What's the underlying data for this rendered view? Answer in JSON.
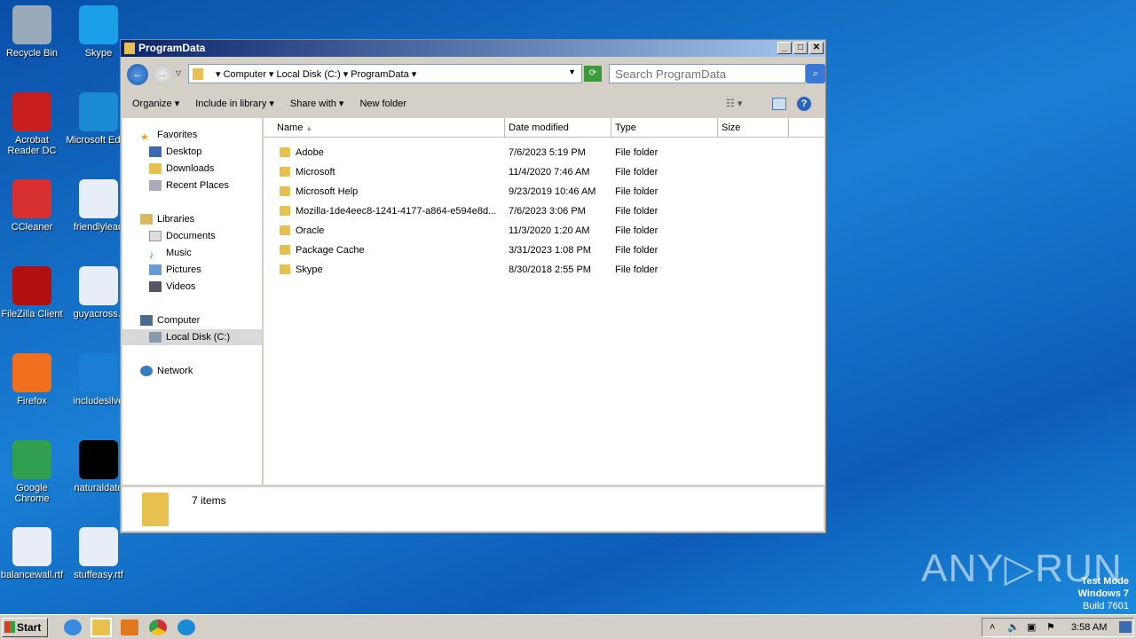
{
  "desktop": {
    "icons": [
      {
        "label": "Recycle Bin",
        "color": "#9ab"
      },
      {
        "label": "Skype",
        "color": "#1a9fe8"
      },
      {
        "label": "Acrobat Reader DC",
        "color": "#c81e1e"
      },
      {
        "label": "Microsoft Edge",
        "color": "#1a8ad4"
      },
      {
        "label": "CCleaner",
        "color": "#d83030"
      },
      {
        "label": "friendlylead",
        "color": "#e8eef8"
      },
      {
        "label": "FileZilla Client",
        "color": "#b01010"
      },
      {
        "label": "guyacross.r",
        "color": "#e8eef8"
      },
      {
        "label": "Firefox",
        "color": "#f07020"
      },
      {
        "label": "includesilve",
        "color": "#1a7fd4"
      },
      {
        "label": "Google Chrome",
        "color": "#30a050"
      },
      {
        "label": "naturaldate",
        "color": "#000"
      },
      {
        "label": "balancewall.rtf",
        "color": "#e8eef8"
      },
      {
        "label": "stuffeasy.rtf",
        "color": "#e8eef8"
      }
    ]
  },
  "window": {
    "title": "ProgramData",
    "breadcrumb": [
      "Computer",
      "Local Disk (C:)",
      "ProgramData"
    ],
    "search_placeholder": "Search ProgramData",
    "toolbar": {
      "organize": "Organize ▾",
      "include": "Include in library ▾",
      "share": "Share with ▾",
      "new_folder": "New folder"
    },
    "nav": {
      "favorites": "Favorites",
      "desktop": "Desktop",
      "downloads": "Downloads",
      "recent": "Recent Places",
      "libraries": "Libraries",
      "documents": "Documents",
      "music": "Music",
      "pictures": "Pictures",
      "videos": "Videos",
      "computer": "Computer",
      "local_disk": "Local Disk (C:)",
      "network": "Network"
    },
    "columns": {
      "name": "Name",
      "date": "Date modified",
      "type": "Type",
      "size": "Size"
    },
    "files": [
      {
        "name": "Adobe",
        "date": "7/6/2023 5:19 PM",
        "type": "File folder"
      },
      {
        "name": "Microsoft",
        "date": "11/4/2020 7:46 AM",
        "type": "File folder"
      },
      {
        "name": "Microsoft Help",
        "date": "9/23/2019 10:46 AM",
        "type": "File folder"
      },
      {
        "name": "Mozilla-1de4eec8-1241-4177-a864-e594e8d...",
        "date": "7/6/2023 3:06 PM",
        "type": "File folder"
      },
      {
        "name": "Oracle",
        "date": "11/3/2020 1:20 AM",
        "type": "File folder"
      },
      {
        "name": "Package Cache",
        "date": "3/31/2023 1:08 PM",
        "type": "File folder"
      },
      {
        "name": "Skype",
        "date": "8/30/2018 2:55 PM",
        "type": "File folder"
      }
    ],
    "status": "7 items"
  },
  "taskbar": {
    "start": "Start",
    "clock": "3:58 AM"
  },
  "watermark": {
    "line1": "Test Mode",
    "line2": "Windows 7",
    "line3": "Build 7601",
    "brand": "ANY ▷ RUN"
  }
}
